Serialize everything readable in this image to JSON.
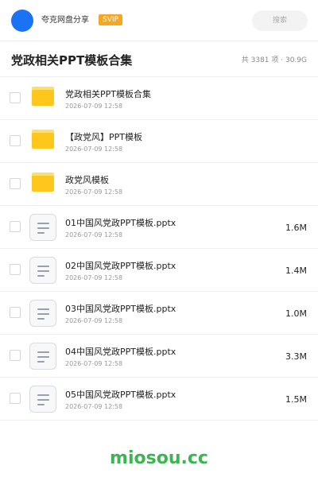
{
  "header": {
    "user_name": "夸克网盘分享",
    "badge": "SVIP",
    "search_placeholder": "搜索"
  },
  "title_bar": {
    "title": "党政相关PPT模板合集",
    "summary": "共 3381 项 · 30.9G"
  },
  "items": [
    {
      "type": "folder",
      "icon": "folder-icon",
      "name": "党政相关PPT模板合集",
      "date": "2026-07-09 12:58",
      "size": ""
    },
    {
      "type": "folder",
      "icon": "folder-icon",
      "name": "【政党风】PPT模板",
      "date": "2026-07-09 12:58",
      "size": ""
    },
    {
      "type": "folder",
      "icon": "folder-icon",
      "name": "政党风模板",
      "date": "2026-07-09 12:58",
      "size": ""
    },
    {
      "type": "file",
      "icon": "document-icon",
      "name": "01中国风党政PPT模板.pptx",
      "date": "2026-07-09 12:58",
      "size": "1.6M"
    },
    {
      "type": "file",
      "icon": "document-icon",
      "name": "02中国风党政PPT模板.pptx",
      "date": "2026-07-09 12:58",
      "size": "1.4M"
    },
    {
      "type": "file",
      "icon": "document-icon",
      "name": "03中国风党政PPT模板.pptx",
      "date": "2026-07-09 12:58",
      "size": "1.0M"
    },
    {
      "type": "file",
      "icon": "document-icon",
      "name": "04中国风党政PPT模板.pptx",
      "date": "2026-07-09 12:58",
      "size": "3.3M"
    },
    {
      "type": "file",
      "icon": "document-icon",
      "name": "05中国风党政PPT模板.pptx",
      "date": "2026-07-09 12:58",
      "size": "1.5M"
    }
  ],
  "footer": {
    "watermark": "miosou.cc"
  },
  "colors": {
    "avatar": "#1a73f5",
    "badge": "#f5a623",
    "folder": "#ffc61b",
    "watermark": "#3cb550"
  }
}
